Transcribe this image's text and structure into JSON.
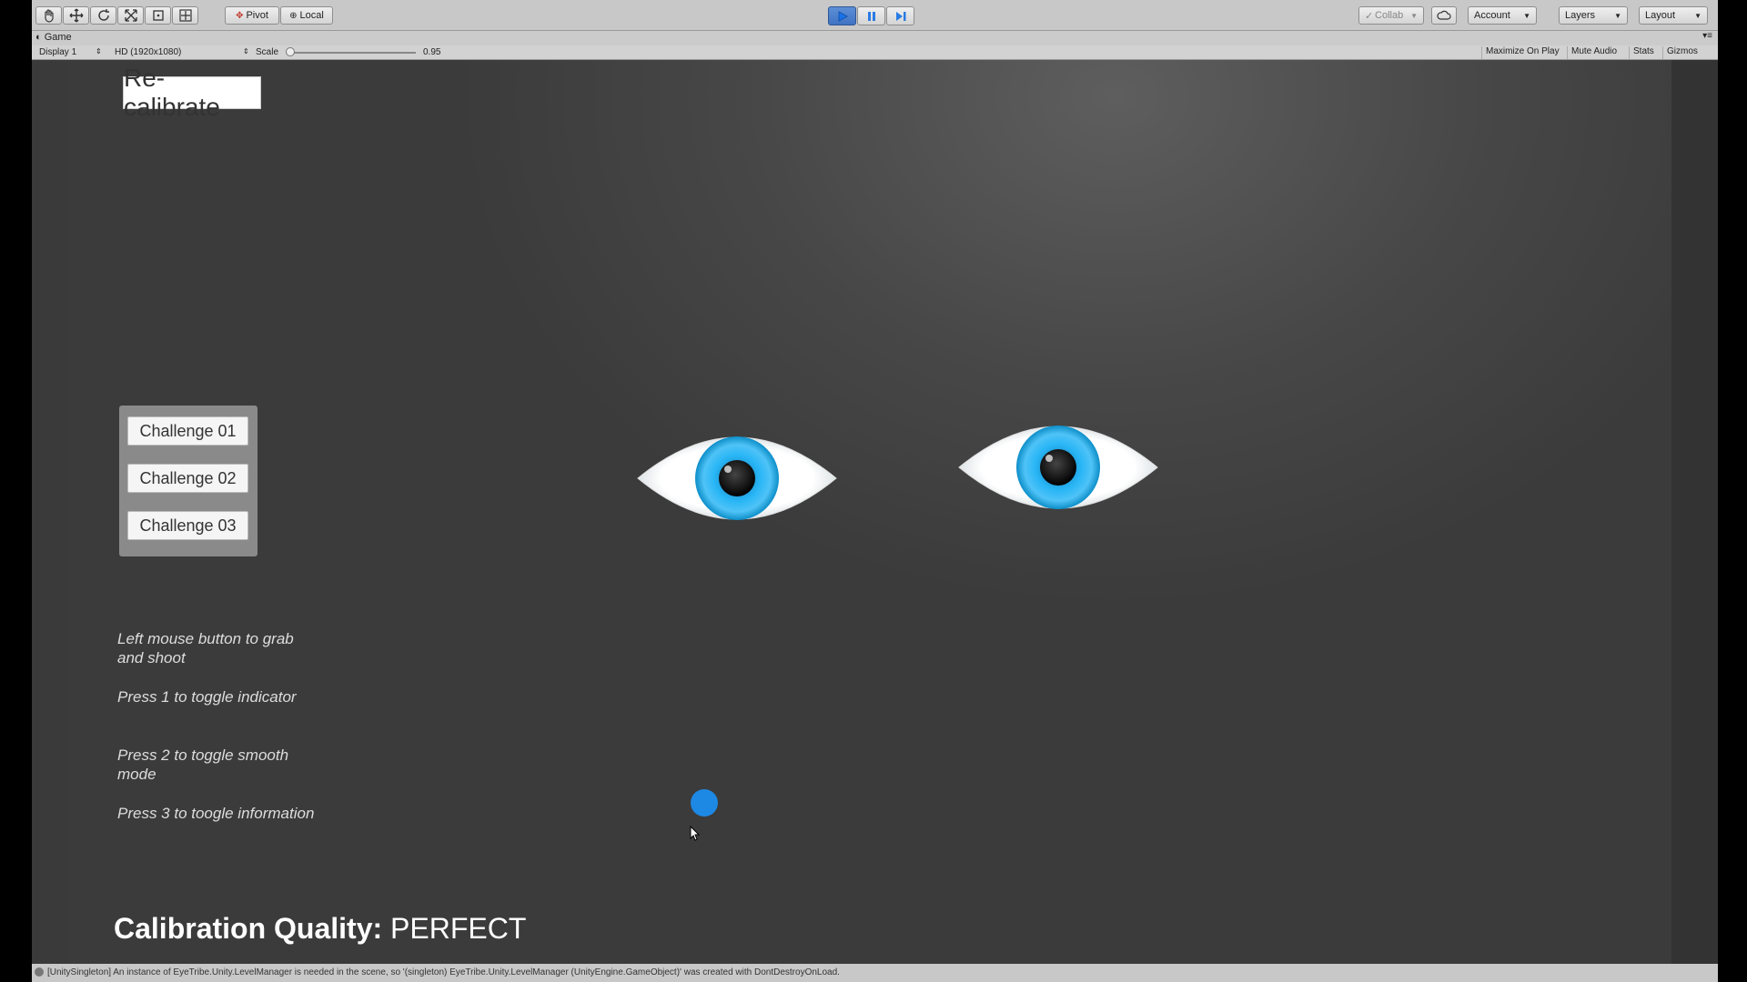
{
  "toolbar": {
    "pivot_label": "Pivot",
    "local_label": "Local",
    "collab_label": "Collab",
    "account_label": "Account",
    "layers_label": "Layers",
    "layout_label": "Layout"
  },
  "game_view": {
    "tab_label": "Game",
    "display_label": "Display 1",
    "resolution_label": "HD (1920x1080)",
    "scale_label": "Scale",
    "scale_value": "0.95",
    "maximize_label": "Maximize On Play",
    "mute_label": "Mute Audio",
    "stats_label": "Stats",
    "gizmos_label": "Gizmos"
  },
  "game": {
    "recalibrate_label": "Re-calibrate",
    "challenges": [
      "Challenge 01",
      "Challenge 02",
      "Challenge 03"
    ],
    "instructions": [
      "Left mouse button to grab and shoot",
      "Press 1 to toggle indicator",
      "Press 2 to toggle smooth mode",
      "Press 3 to toogle information"
    ],
    "quality_label": "Calibration Quality:",
    "quality_value": "PERFECT",
    "colors": {
      "iris": "#29b6f6",
      "gaze_dot": "#1e88e5",
      "background": "#444444"
    }
  },
  "console_message": "[UnitySingleton] An instance of EyeTribe.Unity.LevelManager is needed in the scene, so '(singleton) EyeTribe.Unity.LevelManager (UnityEngine.GameObject)' was created with DontDestroyOnLoad."
}
